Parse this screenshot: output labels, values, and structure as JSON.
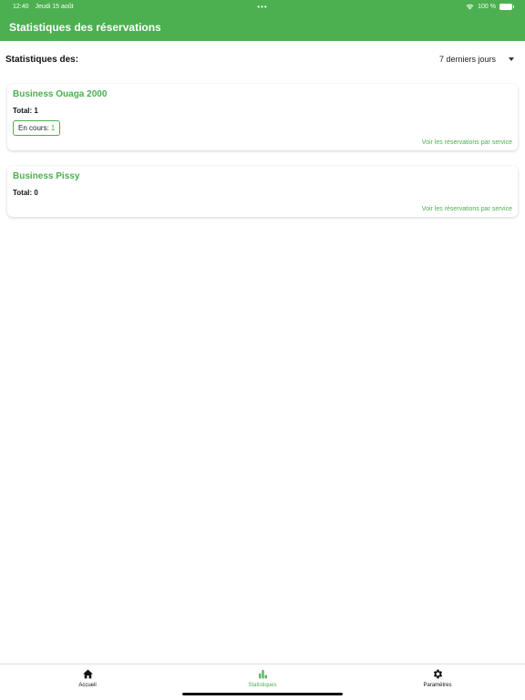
{
  "status_bar": {
    "time": "12:40",
    "date": "Jeudi 15 août",
    "dots": "•••",
    "battery_text": "100 %"
  },
  "app_bar": {
    "title": "Statistiques des réservations"
  },
  "filter": {
    "label": "Statistiques des:",
    "selected_period": "7 derniers jours"
  },
  "businesses": [
    {
      "name": "Business Ouaga 2000",
      "total_text": "Total: 1",
      "chips": [
        {
          "label": "En cours:",
          "value": "1"
        }
      ],
      "link": "Voir les réservations par service"
    },
    {
      "name": "Business Pissy",
      "total_text": "Total: 0",
      "link": "Voir les réservations par service"
    }
  ],
  "bottom_nav": {
    "items": [
      {
        "label": "Accueil",
        "icon": "home-icon"
      },
      {
        "label": "Statistiques",
        "icon": "bar-chart-icon"
      },
      {
        "label": "Paramètres",
        "icon": "gear-icon"
      }
    ],
    "active_index": 1
  },
  "colors": {
    "primary": "#4caf50",
    "text": "#111111",
    "background": "#ffffff"
  }
}
